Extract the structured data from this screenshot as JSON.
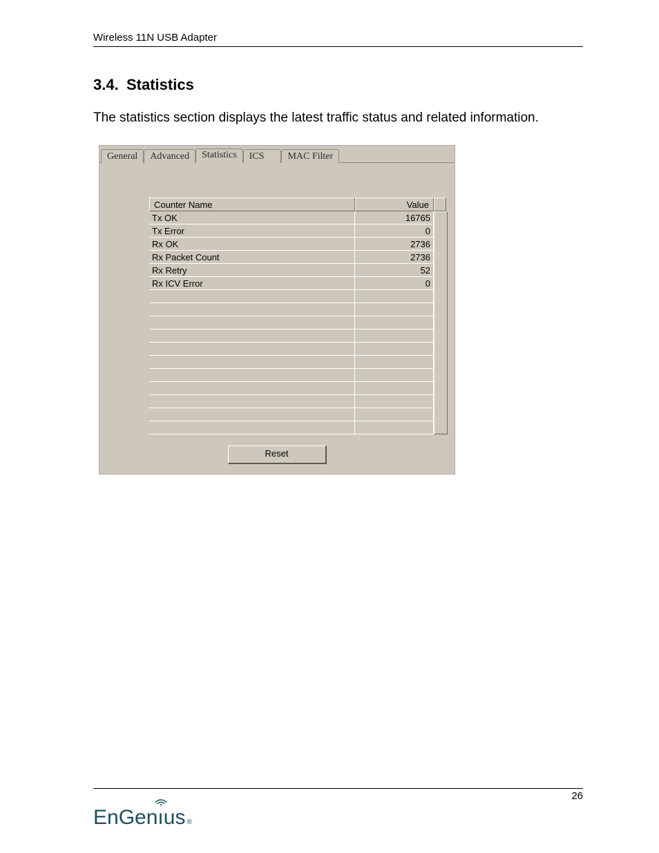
{
  "header": "Wireless 11N USB Adapter",
  "section": {
    "number": "3.4.",
    "title": "Statistics"
  },
  "body_text": "The statistics section displays the latest traffic status and related information.",
  "tabs": [
    "General",
    "Advanced",
    "Statistics",
    "ICS",
    "MAC Filter"
  ],
  "active_tab_index": 2,
  "table": {
    "columns": [
      "Counter Name",
      "Value"
    ],
    "rows": [
      {
        "name": "Tx OK",
        "value": "16765"
      },
      {
        "name": "Tx Error",
        "value": "0"
      },
      {
        "name": "Rx OK",
        "value": "2736"
      },
      {
        "name": "Rx Packet Count",
        "value": "2736"
      },
      {
        "name": "Rx Retry",
        "value": "52"
      },
      {
        "name": "Rx ICV Error",
        "value": "0"
      },
      {
        "name": "",
        "value": ""
      },
      {
        "name": "",
        "value": ""
      },
      {
        "name": "",
        "value": ""
      },
      {
        "name": "",
        "value": ""
      },
      {
        "name": "",
        "value": ""
      },
      {
        "name": "",
        "value": ""
      },
      {
        "name": "",
        "value": ""
      },
      {
        "name": "",
        "value": ""
      },
      {
        "name": "",
        "value": ""
      },
      {
        "name": "",
        "value": ""
      },
      {
        "name": "",
        "value": ""
      }
    ]
  },
  "reset_label": "Reset",
  "page_number": "26",
  "logo_text": "EnGenius"
}
